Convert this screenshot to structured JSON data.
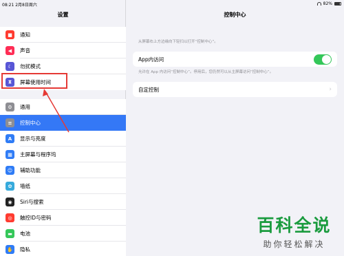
{
  "status": {
    "time_date": "08:21  2月8日周六",
    "battery": "82%"
  },
  "sidebar": {
    "title": "设置",
    "group1": [
      {
        "label": "通知",
        "icon": "bell-icon",
        "color": "#ff3b30",
        "glyph": "■"
      },
      {
        "label": "声音",
        "icon": "speaker-icon",
        "color": "#ff2d55",
        "glyph": "◀"
      },
      {
        "label": "勿扰模式",
        "icon": "moon-icon",
        "color": "#5856d6",
        "glyph": "☾"
      },
      {
        "label": "屏幕使用时间",
        "icon": "hourglass-icon",
        "color": "#5856d6",
        "glyph": "⧗"
      }
    ],
    "group2": [
      {
        "label": "通用",
        "icon": "gear-icon",
        "color": "#8e8e93",
        "glyph": "⚙"
      },
      {
        "label": "控制中心",
        "icon": "control-center-icon",
        "color": "#8e8e93",
        "glyph": "≡",
        "selected": true
      },
      {
        "label": "显示与亮度",
        "icon": "display-icon",
        "color": "#2f7cf6",
        "glyph": "A"
      },
      {
        "label": "主屏幕与程序坞",
        "icon": "home-screen-icon",
        "color": "#2f7cf6",
        "glyph": "▦"
      },
      {
        "label": "辅助功能",
        "icon": "accessibility-icon",
        "color": "#2f7cf6",
        "glyph": "☺"
      },
      {
        "label": "墙纸",
        "icon": "wallpaper-icon",
        "color": "#36aadc",
        "glyph": "✿"
      },
      {
        "label": "Siri与搜索",
        "icon": "siri-icon",
        "color": "#222222",
        "glyph": "◉"
      },
      {
        "label": "触控ID与密码",
        "icon": "fingerprint-icon",
        "color": "#ff3b30",
        "glyph": "◎"
      },
      {
        "label": "电池",
        "icon": "battery-icon",
        "color": "#34c759",
        "glyph": "▬"
      },
      {
        "label": "隐私",
        "icon": "hand-icon",
        "color": "#2f7cf6",
        "glyph": "✋"
      }
    ]
  },
  "detail": {
    "title": "控制中心",
    "description": "从屏幕右上方边缘向下轻扫以打开“控制中心”。",
    "app_access_label": "App内访问",
    "app_access_enabled": true,
    "app_access_hint": "允许在 App 内访问“控制中心”。停用后，您仍然可以从主屏幕访问“控制中心”。",
    "customize_label": "自定控制"
  },
  "watermark": {
    "main": "百科全说",
    "sub": "助你轻松解决"
  }
}
